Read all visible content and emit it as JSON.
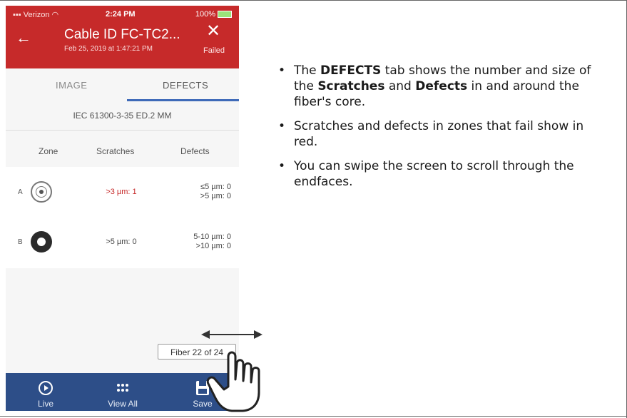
{
  "status_bar": {
    "carrier": "Verizon",
    "time": "2:24 PM",
    "battery": "100%"
  },
  "header": {
    "title": "Cable ID FC-TC2...",
    "subtitle": "Feb 25, 2019 at 1:47:21 PM",
    "status": "Failed",
    "back_icon": "arrow-left-icon",
    "close_icon": "close-icon"
  },
  "tabs": [
    {
      "label": "IMAGE",
      "active": false
    },
    {
      "label": "DEFECTS",
      "active": true
    }
  ],
  "standard": "IEC 61300-3-35 ED.2 MM",
  "table": {
    "headers": {
      "zone": "Zone",
      "scratches": "Scratches",
      "defects": "Defects"
    },
    "rows": [
      {
        "zone": "A",
        "scratches": ">3 µm: 1",
        "defects_1": "≤5 µm: 0",
        "defects_2": ">5 µm: 0",
        "scratches_failed": true
      },
      {
        "zone": "B",
        "scratches": ">5 µm: 0",
        "defects_1": "5-10 µm: 0",
        "defects_2": ">10 µm: 0",
        "scratches_failed": false
      }
    ]
  },
  "fiber_indicator": "Fiber 22 of 24",
  "bottom_nav": [
    {
      "label": "Live",
      "icon": "play-circle-icon"
    },
    {
      "label": "View All",
      "icon": "grid-dots-icon"
    },
    {
      "label": "Save",
      "icon": "floppy-disk-icon"
    }
  ],
  "colors": {
    "header_red": "#c62a2a",
    "nav_blue": "#2d4e88",
    "tab_underline": "#3e6ab8",
    "fail_red": "#c62a2a"
  },
  "bullets": {
    "b1": {
      "p1": "The ",
      "bold1": "DEFECTS",
      "p2": " tab shows the number and size of the ",
      "bold2": "Scratches",
      "p3": " and ",
      "bold3": "Defects",
      "p4": " in and around the fiber's core."
    },
    "b2": "Scratches and defects in zones that fail show in red.",
    "b3": "You can swipe the screen to scroll through the endfaces."
  }
}
